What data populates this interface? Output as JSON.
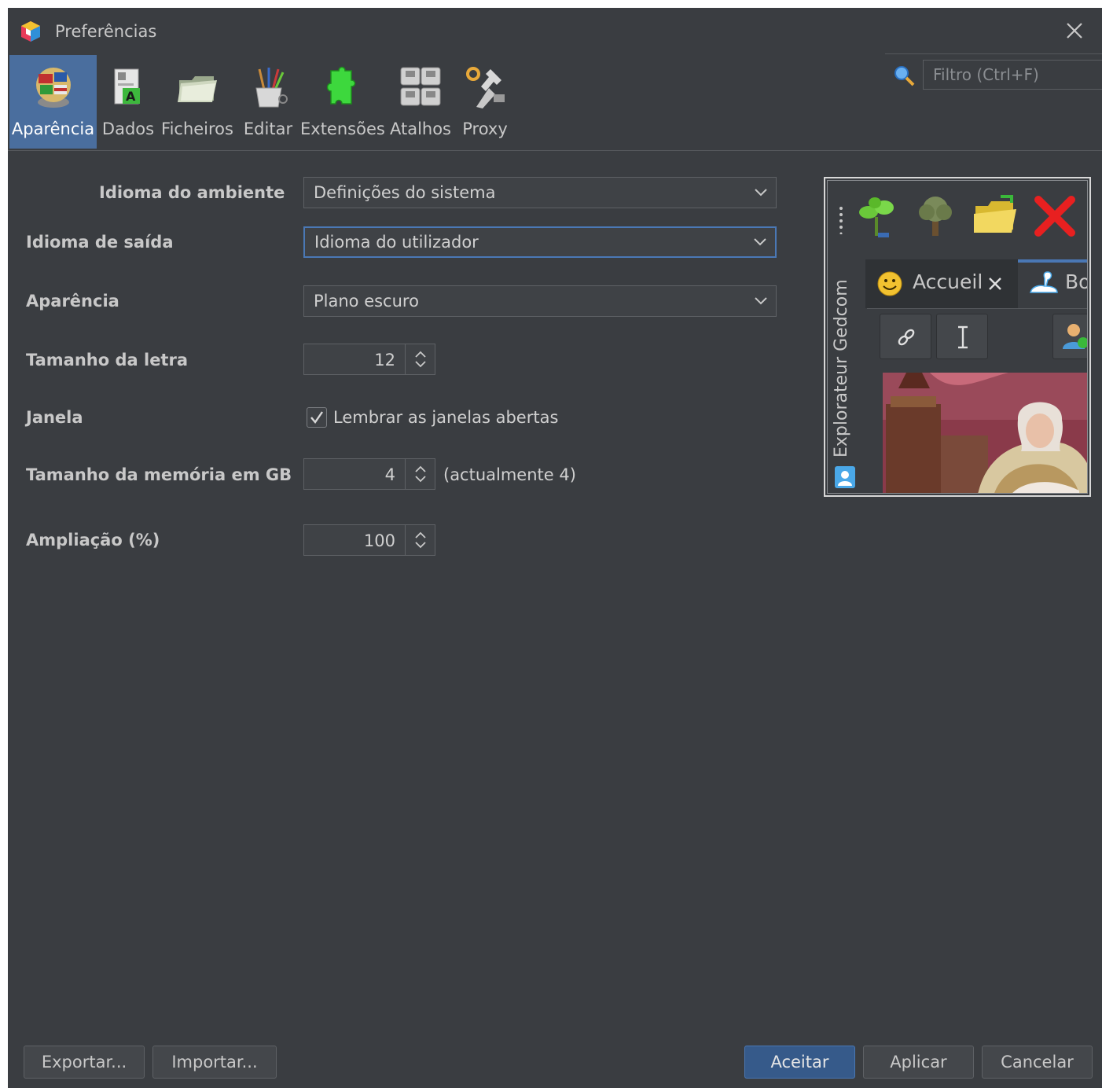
{
  "window": {
    "title": "Preferências",
    "close_icon": "close-icon",
    "app_icon": "app-cube-icon"
  },
  "toolbar": {
    "categories": [
      {
        "label": "Aparência",
        "icon": "globe-flags-icon",
        "active": true
      },
      {
        "label": "Dados",
        "icon": "data-document-icon",
        "active": false
      },
      {
        "label": "Ficheiros",
        "icon": "folder-icon",
        "active": false
      },
      {
        "label": "Editar",
        "icon": "brushes-cup-icon",
        "active": false
      },
      {
        "label": "Extensões",
        "icon": "puzzle-icon",
        "active": false
      },
      {
        "label": "Atalhos",
        "icon": "keyboard-keys-icon",
        "active": false
      },
      {
        "label": "Proxy",
        "icon": "tools-icon",
        "active": false
      }
    ],
    "filter_placeholder": "Filtro (Ctrl+F)"
  },
  "form": {
    "environment_language": {
      "label": "Idioma do ambiente",
      "value": "Definições do sistema"
    },
    "output_language": {
      "label": "Idioma de saída",
      "value": "Idioma do utilizador"
    },
    "appearance": {
      "label": "Aparência",
      "value": "Plano escuro"
    },
    "font_size": {
      "label": "Tamanho da letra",
      "value": "12"
    },
    "window": {
      "label": "Janela",
      "checkbox_label": "Lembrar as janelas abertas",
      "checked": true
    },
    "memory": {
      "label": "Tamanho da memória em GB",
      "value": "4",
      "note": "(actualmente 4)"
    },
    "zoom": {
      "label": "Ampliação (%)",
      "value": "100"
    }
  },
  "preview": {
    "sidebar_label": "Explorateur Gedcom",
    "tab_active": "Accueil",
    "tab_second": "Bo",
    "toolbar_icons": [
      "tree-sprout-icon",
      "tree-icon",
      "open-folder-icon",
      "red-x-icon"
    ]
  },
  "buttons": {
    "export": "Exportar...",
    "import": "Importar...",
    "accept": "Aceitar",
    "apply": "Aplicar",
    "cancel": "Cancelar"
  },
  "colors": {
    "background": "#3a3d41",
    "accent": "#4a6e9e",
    "focus_border": "#4a78b5",
    "text": "#c8c8c8"
  }
}
